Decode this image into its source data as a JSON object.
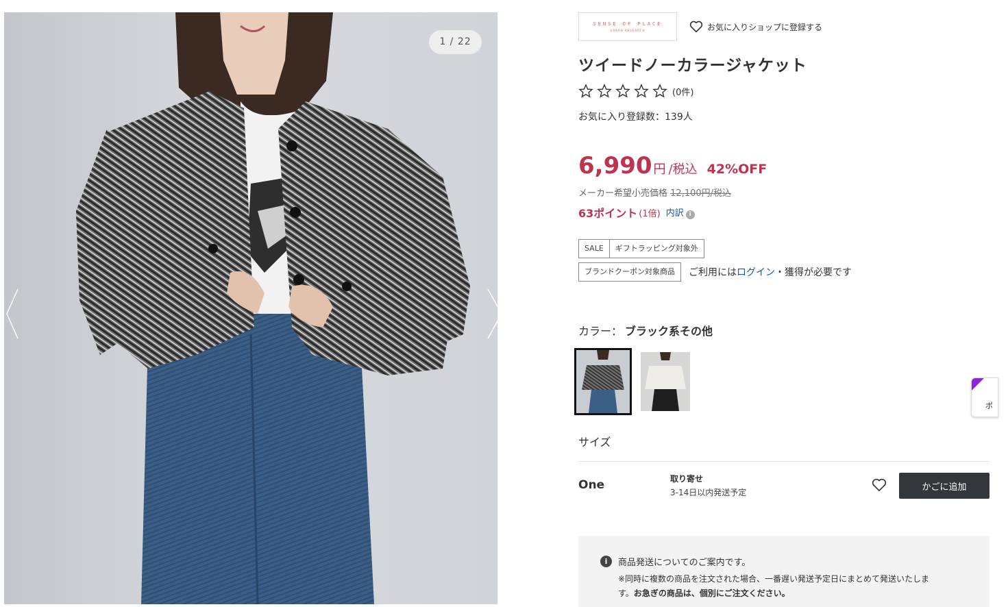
{
  "gallery": {
    "counter": "1 / 22"
  },
  "brand": {
    "logo_text": "SENSE OF PLACE",
    "logo_subtext": "URBAN RESEARCH",
    "fav_shop_label": "お気に入りショップに登録する"
  },
  "product": {
    "title": "ツイードノーカラージャケット",
    "review_count": "(0件)",
    "favorite_count": "お気に入り登録数：139人",
    "price": "6,990",
    "currency": "円",
    "tax_label": "/税込",
    "discount": "42%OFF",
    "msrp_label": "メーカー希望小売価格",
    "msrp_value": "12,100円/税込",
    "points": "63ポイント",
    "points_multiplier": "(1倍)",
    "points_detail_link": "内訳",
    "accent_color": "#c0334f"
  },
  "tags": {
    "sale": "SALE",
    "gift": "ギフトラッピング対象外",
    "coupon": "ブランドクーポン対象商品",
    "coupon_note_prefix": "ご利用には",
    "login_link": "ログイン",
    "coupon_note_suffix": "・獲得が必要です"
  },
  "color": {
    "label": "カラー：",
    "selected": "ブラック系その他"
  },
  "size": {
    "label": "サイズ",
    "name": "One",
    "stock_status": "取り寄せ",
    "ship_estimate": "3-14日以内発送予定",
    "cart_button": "かごに追加"
  },
  "notice": {
    "title": "商品発送についてのご案内です。",
    "body_line1": "※同時に複数の商品を注文された場合、一番遅い発送予定日にまとめて発送いたしま",
    "body_line2_prefix": "す。",
    "body_line2_bold": "お急ぎの商品は、個別にご注文ください。"
  },
  "side_widget": {
    "label": "ポ"
  }
}
